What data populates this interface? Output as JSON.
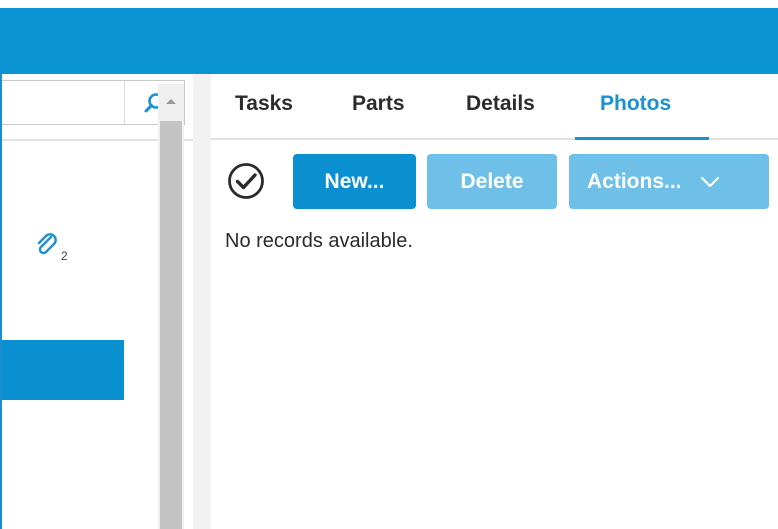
{
  "colors": {
    "accent": "#0a94d3",
    "selection": "#0a8fd1",
    "button_primary": "#0a8fd1",
    "button_disabled": "#6ec0e8"
  },
  "left_pane": {
    "search": {
      "value": "",
      "placeholder": ""
    },
    "attachment": {
      "icon": "paperclip-icon",
      "count": "2"
    }
  },
  "tabs": [
    {
      "label": "Tasks"
    },
    {
      "label": "Parts"
    },
    {
      "label": "Details"
    },
    {
      "label": "Photos",
      "active": true
    }
  ],
  "toolbar": {
    "select_all_icon": "check-circle-icon",
    "new_label": "New...",
    "delete_label": "Delete",
    "actions_label": "Actions..."
  },
  "content": {
    "empty_message": "No records available."
  }
}
